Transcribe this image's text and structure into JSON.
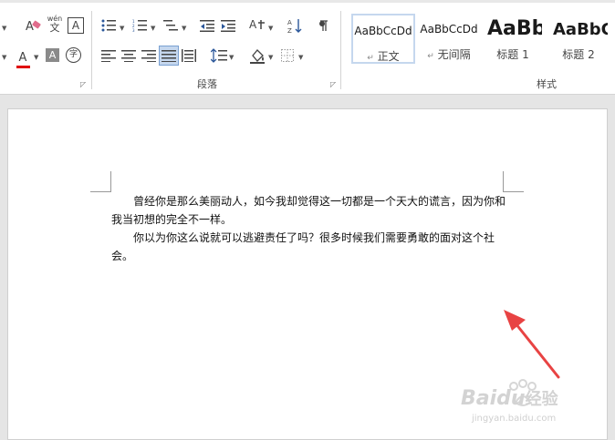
{
  "ribbon": {
    "font_group_buttons": {
      "clear_format": "A",
      "pinyin_top": "wén",
      "pinyin_bottom": "文",
      "char_border": "A",
      "font_color": "A",
      "char_shading": "A",
      "enclose_char": "字"
    },
    "paragraph_label": "段落",
    "styles_label": "样式",
    "styles": [
      {
        "preview": "AaBbCcDd",
        "name": "正文",
        "selected": true
      },
      {
        "preview": "AaBbCcDd",
        "name": "无间隔",
        "selected": false
      },
      {
        "preview": "AaBb",
        "name": "标题 1",
        "selected": false
      },
      {
        "preview": "AaBbC",
        "name": "标题 2",
        "selected": false
      }
    ],
    "colors": {
      "accent": "#2b579a",
      "font_color_bar": "#e00000",
      "selected_button": "#c5d7ee"
    }
  },
  "document": {
    "paragraphs": [
      "曾经你是那么美丽动人，如今我却觉得这一切都是一个天大的谎言，因为你和我当初想的完全不一样。",
      "你以为你这么说就可以逃避责任了吗？很多时候我们需要勇敢的面对这个社会。"
    ]
  },
  "annotation": {
    "arrow_color": "#e84343"
  },
  "watermark": {
    "brand": "Baidu",
    "brand_suffix": "经验",
    "url": "jingyan.baidu.com"
  }
}
